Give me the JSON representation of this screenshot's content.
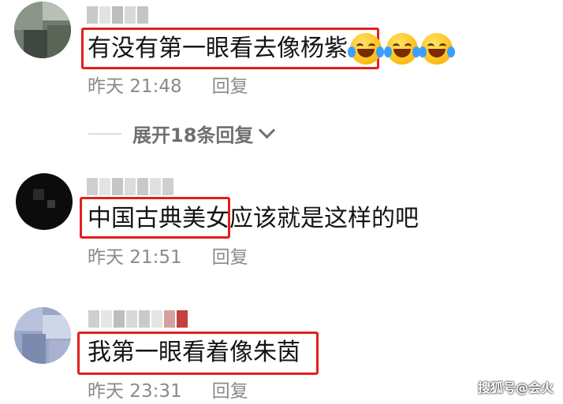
{
  "comments": [
    {
      "text_highlighted": "有没有第一眼看去像杨紫",
      "text_rest": "",
      "time": "昨天 21:48",
      "reply_label": "回复",
      "emoji_count": 3
    },
    {
      "text_highlighted": "中国古典美女",
      "text_rest": "应该就是这样的吧",
      "time": "昨天 21:51",
      "reply_label": "回复"
    },
    {
      "text_highlighted": "我第一眼看着像朱茵",
      "text_rest": "",
      "time": "昨天 23:31",
      "reply_label": "回复"
    }
  ],
  "expand_replies": {
    "label": "展开18条回复"
  },
  "watermark": "搜狐号@会火",
  "colors": {
    "highlight_box": "#e0201c",
    "meta_text": "#8a8a8a",
    "expand_text": "#707070"
  }
}
